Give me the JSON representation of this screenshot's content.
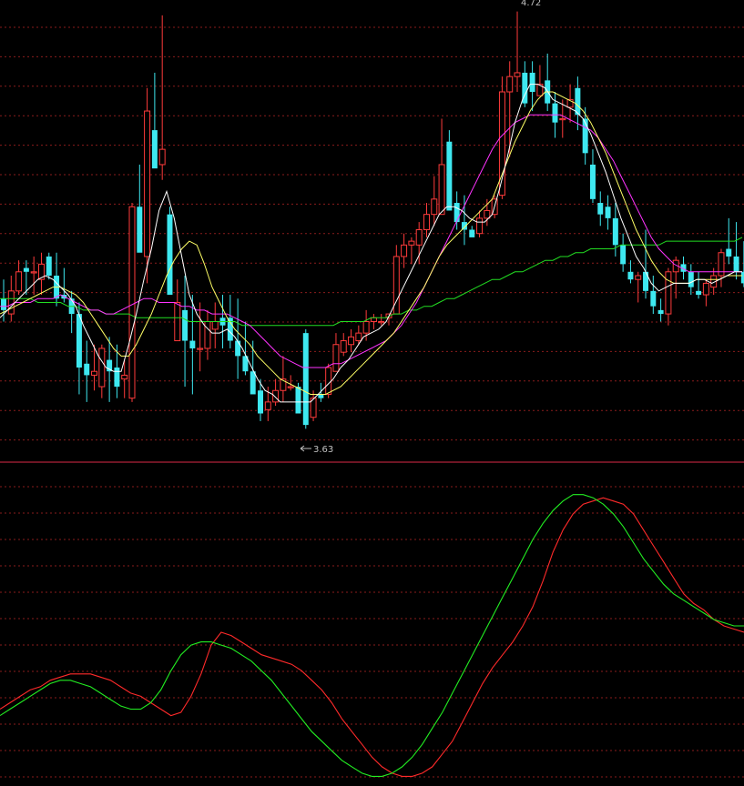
{
  "chart_data": [
    {
      "type": "candlestick",
      "title": "",
      "xlabel": "",
      "ylabel": "",
      "ylim": [
        3.55,
        4.75
      ],
      "grid": true,
      "annotations": {
        "high_label": "4.72",
        "low_label": "3.63"
      },
      "colors": {
        "up": "#ff3b3b",
        "down": "#3ee8f0",
        "ma5": "#ffffff",
        "ma10": "#ffff66",
        "ma20": "#ff33ff",
        "ma60": "#22dd22"
      },
      "ohlc": [
        [
          3.97,
          4.02,
          3.91,
          3.94
        ],
        [
          3.93,
          4.03,
          3.91,
          3.99
        ],
        [
          3.99,
          4.07,
          3.98,
          4.04
        ],
        [
          4.05,
          4.07,
          3.98,
          4.04
        ],
        [
          4.04,
          4.08,
          3.98,
          4.04
        ],
        [
          4.02,
          4.09,
          3.98,
          4.06
        ],
        [
          4.08,
          4.09,
          4.02,
          4.03
        ],
        [
          4.03,
          4.09,
          3.95,
          3.97
        ],
        [
          3.98,
          4.05,
          3.96,
          3.97
        ],
        [
          3.97,
          3.99,
          3.88,
          3.93
        ],
        [
          3.93,
          3.96,
          3.72,
          3.79
        ],
        [
          3.8,
          3.86,
          3.7,
          3.77
        ],
        [
          3.77,
          3.85,
          3.73,
          3.78
        ],
        [
          3.74,
          3.85,
          3.71,
          3.84
        ],
        [
          3.81,
          3.87,
          3.7,
          3.78
        ],
        [
          3.79,
          3.85,
          3.71,
          3.74
        ],
        [
          3.76,
          3.81,
          3.71,
          3.77
        ],
        [
          3.71,
          4.22,
          3.7,
          4.21
        ],
        [
          4.21,
          4.32,
          4.12,
          4.09
        ],
        [
          4.08,
          4.52,
          4.01,
          4.46
        ],
        [
          4.41,
          4.56,
          4.34,
          4.31
        ],
        [
          4.32,
          4.71,
          4.28,
          4.36
        ],
        [
          4.19,
          4.21,
          3.98,
          3.98
        ],
        [
          3.86,
          4.02,
          3.88,
          3.96
        ],
        [
          3.94,
          4.03,
          3.74,
          3.86
        ],
        [
          3.86,
          3.98,
          3.72,
          3.84
        ],
        [
          3.84,
          3.96,
          3.78,
          3.84
        ],
        [
          3.84,
          3.94,
          3.81,
          3.91
        ],
        [
          3.89,
          3.96,
          3.84,
          3.91
        ],
        [
          3.92,
          3.98,
          3.84,
          3.9
        ],
        [
          3.92,
          3.98,
          3.84,
          3.86
        ],
        [
          3.86,
          3.97,
          3.76,
          3.82
        ],
        [
          3.82,
          3.91,
          3.77,
          3.78
        ],
        [
          3.78,
          3.86,
          3.78,
          3.72
        ],
        [
          3.73,
          3.76,
          3.65,
          3.67
        ],
        [
          3.68,
          3.74,
          3.65,
          3.7
        ],
        [
          3.7,
          3.76,
          3.69,
          3.73
        ],
        [
          3.73,
          3.82,
          3.7,
          3.76
        ],
        [
          3.74,
          3.77,
          3.73,
          3.74
        ],
        [
          3.74,
          3.75,
          3.68,
          3.67
        ],
        [
          3.88,
          3.89,
          3.63,
          3.64
        ],
        [
          3.66,
          3.73,
          3.65,
          3.71
        ],
        [
          3.72,
          3.75,
          3.7,
          3.71
        ],
        [
          3.72,
          3.8,
          3.71,
          3.79
        ],
        [
          3.78,
          3.88,
          3.78,
          3.85
        ],
        [
          3.83,
          3.88,
          3.82,
          3.86
        ],
        [
          3.85,
          3.89,
          3.83,
          3.87
        ],
        [
          3.86,
          3.9,
          3.85,
          3.88
        ],
        [
          3.88,
          3.94,
          3.86,
          3.91
        ],
        [
          3.91,
          3.93,
          3.89,
          3.92
        ],
        [
          3.91,
          3.93,
          3.9,
          3.91
        ],
        [
          3.92,
          3.93,
          3.9,
          3.93
        ],
        [
          3.93,
          4.11,
          3.93,
          4.08
        ],
        [
          4.08,
          4.14,
          4.05,
          4.11
        ],
        [
          4.11,
          4.13,
          4.06,
          4.12
        ],
        [
          4.11,
          4.17,
          4.06,
          4.15
        ],
        [
          4.15,
          4.22,
          4.13,
          4.19
        ],
        [
          4.19,
          4.29,
          4.16,
          4.23
        ],
        [
          4.19,
          4.44,
          4.19,
          4.32
        ],
        [
          4.38,
          4.41,
          4.22,
          4.2
        ],
        [
          4.22,
          4.25,
          4.15,
          4.17
        ],
        [
          4.17,
          4.24,
          4.11,
          4.15
        ],
        [
          4.15,
          4.16,
          4.14,
          4.13
        ],
        [
          4.14,
          4.2,
          4.13,
          4.18
        ],
        [
          4.18,
          4.23,
          4.16,
          4.2
        ],
        [
          4.19,
          4.24,
          4.18,
          4.23
        ],
        [
          4.24,
          4.55,
          4.23,
          4.51
        ],
        [
          4.51,
          4.59,
          4.34,
          4.55
        ],
        [
          4.55,
          4.72,
          4.51,
          4.56
        ],
        [
          4.56,
          4.59,
          4.47,
          4.48
        ],
        [
          4.56,
          4.59,
          4.46,
          4.51
        ],
        [
          4.5,
          4.58,
          4.5,
          4.53
        ],
        [
          4.54,
          4.61,
          4.46,
          4.48
        ],
        [
          4.48,
          4.51,
          4.39,
          4.43
        ],
        [
          4.44,
          4.49,
          4.39,
          4.44
        ],
        [
          4.47,
          4.53,
          4.43,
          4.49
        ],
        [
          4.52,
          4.55,
          4.41,
          4.45
        ],
        [
          4.44,
          4.47,
          4.32,
          4.35
        ],
        [
          4.32,
          4.36,
          4.22,
          4.23
        ],
        [
          4.22,
          4.25,
          4.16,
          4.19
        ],
        [
          4.21,
          4.24,
          4.15,
          4.18
        ],
        [
          4.18,
          4.22,
          4.08,
          4.11
        ],
        [
          4.11,
          4.14,
          4.04,
          4.06
        ],
        [
          4.04,
          4.07,
          4.01,
          4.02
        ],
        [
          4.02,
          4.04,
          3.96,
          4.03
        ],
        [
          4.04,
          4.15,
          3.97,
          3.99
        ],
        [
          3.99,
          4.03,
          3.93,
          3.95
        ],
        [
          3.94,
          3.97,
          3.91,
          3.93
        ],
        [
          3.93,
          4.05,
          3.9,
          4.04
        ],
        [
          4.04,
          4.08,
          3.97,
          4.07
        ],
        [
          4.06,
          4.08,
          4.02,
          4.04
        ],
        [
          4.04,
          4.06,
          3.98,
          4.0
        ],
        [
          3.99,
          4.04,
          3.97,
          3.98
        ],
        [
          3.98,
          4.02,
          3.95,
          4.01
        ],
        [
          4.0,
          4.05,
          3.98,
          4.03
        ],
        [
          4.03,
          4.1,
          4.0,
          4.09
        ],
        [
          4.1,
          4.18,
          4.06,
          4.08
        ],
        [
          4.08,
          4.17,
          4.02,
          4.04
        ],
        [
          4.04,
          4.12,
          4.0,
          4.01
        ]
      ],
      "ma5": [
        3.92,
        3.94,
        3.96,
        3.98,
        4.0,
        4.02,
        4.03,
        4.02,
        4.0,
        3.98,
        3.95,
        3.9,
        3.86,
        3.82,
        3.79,
        3.78,
        3.78,
        3.85,
        3.93,
        4.02,
        4.1,
        4.2,
        4.25,
        4.18,
        4.08,
        3.98,
        3.93,
        3.9,
        3.88,
        3.88,
        3.89,
        3.87,
        3.84,
        3.8,
        3.76,
        3.73,
        3.72,
        3.7,
        3.7,
        3.7,
        3.7,
        3.7,
        3.72,
        3.74,
        3.76,
        3.79,
        3.81,
        3.84,
        3.87,
        3.88,
        3.89,
        3.91,
        3.95,
        3.99,
        4.03,
        4.07,
        4.11,
        4.15,
        4.19,
        4.21,
        4.21,
        4.2,
        4.18,
        4.17,
        4.17,
        4.19,
        4.26,
        4.34,
        4.43,
        4.49,
        4.53,
        4.53,
        4.52,
        4.49,
        4.48,
        4.47,
        4.46,
        4.44,
        4.4,
        4.35,
        4.3,
        4.24,
        4.18,
        4.13,
        4.08,
        4.05,
        4.01,
        3.99,
        4.0,
        4.01,
        4.01,
        4.01,
        4.02,
        4.02,
        4.01,
        4.02,
        4.03,
        4.04,
        4.04
      ],
      "ma10": [
        3.93,
        3.94,
        3.95,
        3.96,
        3.97,
        3.98,
        3.99,
        4.0,
        4.0,
        3.99,
        3.98,
        3.96,
        3.93,
        3.9,
        3.87,
        3.84,
        3.82,
        3.82,
        3.85,
        3.89,
        3.93,
        3.98,
        4.03,
        4.07,
        4.1,
        4.12,
        4.11,
        4.06,
        4.0,
        3.96,
        3.92,
        3.89,
        3.87,
        3.85,
        3.82,
        3.8,
        3.78,
        3.76,
        3.75,
        3.74,
        3.73,
        3.72,
        3.72,
        3.72,
        3.73,
        3.74,
        3.76,
        3.78,
        3.8,
        3.82,
        3.84,
        3.86,
        3.88,
        3.91,
        3.94,
        3.97,
        4.0,
        4.04,
        4.08,
        4.11,
        4.13,
        4.15,
        4.17,
        4.19,
        4.21,
        4.23,
        4.28,
        4.33,
        4.38,
        4.42,
        4.46,
        4.49,
        4.51,
        4.51,
        4.5,
        4.49,
        4.48,
        4.46,
        4.43,
        4.39,
        4.35,
        4.3,
        4.25,
        4.2,
        4.15,
        4.11,
        4.07,
        4.04,
        4.02,
        4.01,
        4.01,
        4.01,
        4.02,
        4.02,
        4.02,
        4.02,
        4.03,
        4.03,
        4.03
      ],
      "ma20": [
        3.95,
        3.95,
        3.96,
        3.96,
        3.96,
        3.97,
        3.97,
        3.97,
        3.98,
        3.97,
        3.96,
        3.95,
        3.94,
        3.94,
        3.93,
        3.93,
        3.94,
        3.95,
        3.96,
        3.97,
        3.97,
        3.96,
        3.96,
        3.96,
        3.95,
        3.95,
        3.94,
        3.94,
        3.93,
        3.93,
        3.93,
        3.92,
        3.91,
        3.9,
        3.88,
        3.86,
        3.84,
        3.82,
        3.81,
        3.8,
        3.79,
        3.79,
        3.79,
        3.79,
        3.8,
        3.8,
        3.81,
        3.82,
        3.83,
        3.84,
        3.85,
        3.86,
        3.88,
        3.9,
        3.93,
        3.96,
        4.0,
        4.04,
        4.08,
        4.12,
        4.16,
        4.2,
        4.24,
        4.28,
        4.32,
        4.36,
        4.39,
        4.41,
        4.43,
        4.44,
        4.45,
        4.45,
        4.45,
        4.45,
        4.45,
        4.44,
        4.43,
        4.42,
        4.41,
        4.39,
        4.36,
        4.33,
        4.29,
        4.25,
        4.21,
        4.17,
        4.13,
        4.1,
        4.08,
        4.06,
        4.05,
        4.04,
        4.04,
        4.04,
        4.04,
        4.04,
        4.04,
        4.04,
        4.04
      ],
      "ma60": [
        3.97,
        3.97,
        3.97,
        3.97,
        3.97,
        3.96,
        3.96,
        3.96,
        3.96,
        3.95,
        3.95,
        3.94,
        3.94,
        3.94,
        3.93,
        3.93,
        3.93,
        3.93,
        3.92,
        3.92,
        3.92,
        3.92,
        3.92,
        3.92,
        3.92,
        3.91,
        3.91,
        3.91,
        3.91,
        3.91,
        3.91,
        3.91,
        3.9,
        3.9,
        3.9,
        3.9,
        3.9,
        3.9,
        3.9,
        3.9,
        3.9,
        3.9,
        3.9,
        3.9,
        3.9,
        3.91,
        3.91,
        3.91,
        3.91,
        3.92,
        3.92,
        3.92,
        3.93,
        3.93,
        3.94,
        3.94,
        3.95,
        3.95,
        3.96,
        3.97,
        3.97,
        3.98,
        3.99,
        4.0,
        4.01,
        4.02,
        4.02,
        4.03,
        4.04,
        4.04,
        4.05,
        4.06,
        4.07,
        4.07,
        4.08,
        4.08,
        4.09,
        4.09,
        4.1,
        4.1,
        4.1,
        4.1,
        4.11,
        4.11,
        4.11,
        4.11,
        4.11,
        4.11,
        4.12,
        4.12,
        4.12,
        4.12,
        4.12,
        4.12,
        4.12,
        4.12,
        4.12,
        4.12,
        4.13
      ]
    },
    {
      "type": "line",
      "title": "",
      "xlabel": "",
      "ylabel": "",
      "ylim": [
        0,
        100
      ],
      "grid": true,
      "series": [
        {
          "color": "#ff2a2a",
          "values": [
            24,
            26,
            28,
            30,
            31,
            33,
            34,
            35,
            35,
            35,
            34,
            33,
            31,
            29,
            28,
            26,
            24,
            22,
            23,
            28,
            35,
            44,
            48,
            47,
            45,
            43,
            41,
            40,
            39,
            38,
            36,
            33,
            30,
            26,
            21,
            17,
            13,
            9,
            6,
            4,
            3,
            3,
            4,
            6,
            10,
            14,
            20,
            26,
            32,
            37,
            41,
            45,
            50,
            56,
            64,
            73,
            80,
            85,
            88,
            89,
            90,
            89,
            88,
            85,
            80,
            75,
            70,
            65,
            60,
            57,
            55,
            52,
            50,
            49,
            48
          ]
        },
        {
          "color": "#22ee22",
          "values": [
            22,
            24,
            26,
            28,
            30,
            32,
            33,
            33,
            32,
            31,
            29,
            27,
            25,
            24,
            24,
            26,
            30,
            36,
            41,
            44,
            45,
            45,
            44,
            43,
            41,
            39,
            36,
            33,
            29,
            25,
            21,
            17,
            14,
            11,
            8,
            6,
            4,
            3,
            3,
            4,
            6,
            9,
            13,
            18,
            23,
            29,
            35,
            41,
            47,
            53,
            59,
            65,
            71,
            77,
            82,
            86,
            89,
            91,
            91,
            90,
            88,
            85,
            81,
            76,
            71,
            67,
            63,
            60,
            58,
            56,
            54,
            52,
            51,
            50,
            50
          ]
        }
      ]
    }
  ]
}
